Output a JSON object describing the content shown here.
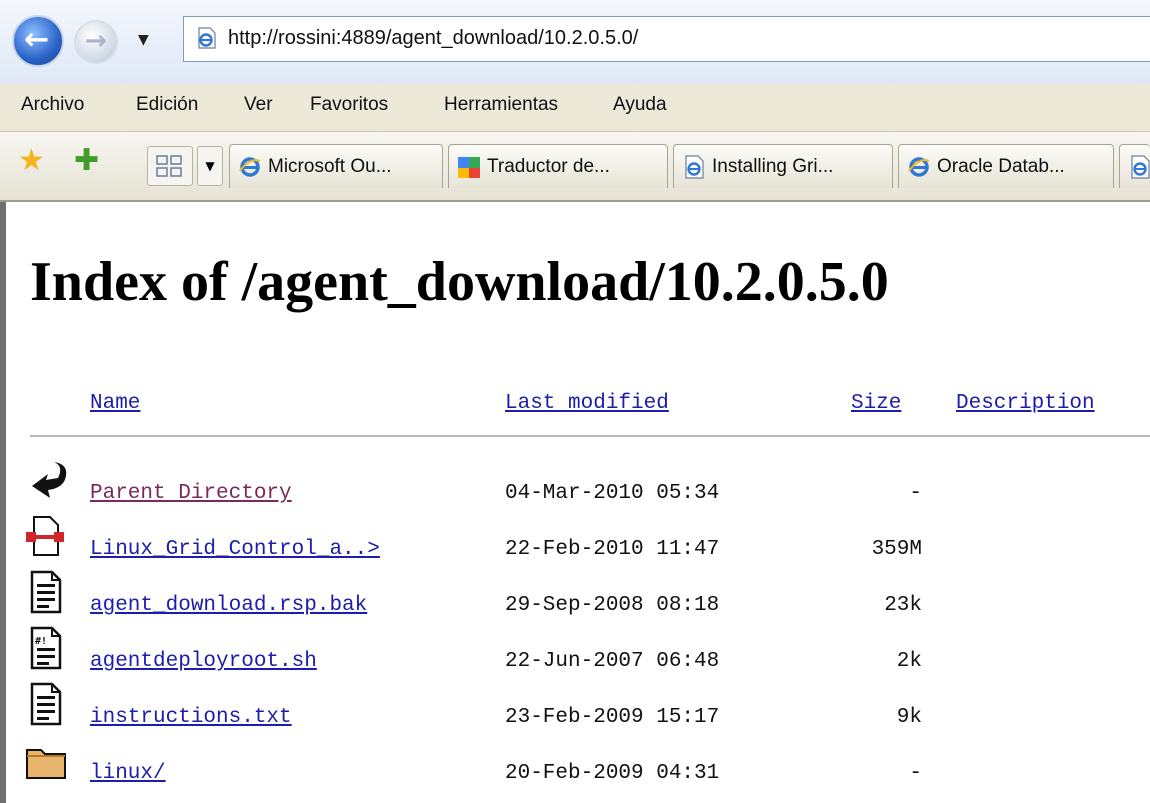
{
  "browser": {
    "address": "http://rossini:4889/agent_download/10.2.0.5.0/",
    "menu": [
      "Archivo",
      "Edición",
      "Ver",
      "Favoritos",
      "Herramientas",
      "Ayuda"
    ],
    "tabs": [
      {
        "label": "Microsoft Ou...",
        "icon": "ie-icon"
      },
      {
        "label": "Traductor de...",
        "icon": "google-translate-icon"
      },
      {
        "label": "Installing Gri...",
        "icon": "ie-page-icon"
      },
      {
        "label": "Oracle Datab...",
        "icon": "ie-icon"
      }
    ]
  },
  "page": {
    "title": "Index of /agent_download/10.2.0.5.0",
    "columns": {
      "name": "Name",
      "last_modified": "Last modified",
      "size": "Size",
      "description": "Description"
    },
    "rows": [
      {
        "icon": "back-arrow-icon",
        "name": "Parent Directory",
        "modified": "04-Mar-2010 05:34",
        "size": "-"
      },
      {
        "icon": "compressed-file-icon",
        "name": "Linux_Grid_Control_a..>",
        "modified": "22-Feb-2010 11:47",
        "size": "359M"
      },
      {
        "icon": "text-file-icon",
        "name": "agent_download.rsp.bak",
        "modified": "29-Sep-2008 08:18",
        "size": "23k"
      },
      {
        "icon": "script-file-icon",
        "name": "agentdeployroot.sh",
        "modified": "22-Jun-2007 06:48",
        "size": "2k"
      },
      {
        "icon": "text-file-icon",
        "name": "instructions.txt",
        "modified": "23-Feb-2009 15:17",
        "size": "9k"
      },
      {
        "icon": "folder-icon",
        "name": "linux/",
        "modified": "20-Feb-2009 04:31",
        "size": "-"
      }
    ]
  }
}
